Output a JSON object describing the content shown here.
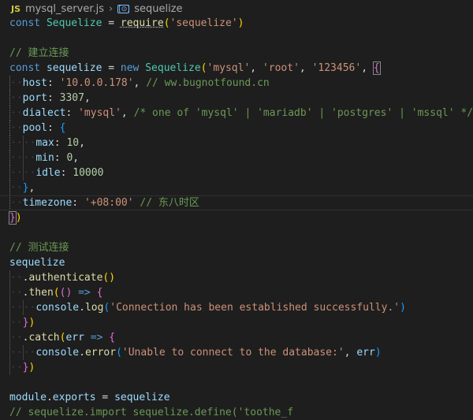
{
  "breadcrumb": {
    "file_icon": "JS",
    "file_name": "mysql_server.js",
    "separator": "›",
    "symbol_icon": "[⊙]",
    "symbol_name": "sequelize"
  },
  "code": {
    "l1": {
      "kw": "const",
      "name": "Sequelize",
      "eq": " = ",
      "fn": "require",
      "arg": "'sequelize'"
    },
    "l3": {
      "comment": "// 建立连接"
    },
    "l4": {
      "kw": "const",
      "name": "sequelize",
      "eq": " = ",
      "new": "new",
      "cls": "Sequelize",
      "a1": "'mysql'",
      "a2": "'root'",
      "a3": "'123456'"
    },
    "l5": {
      "key": "host",
      "val": "'10.0.0.178'",
      "comment": "// ww.bugnotfound.cn"
    },
    "l6": {
      "key": "port",
      "val": "3307"
    },
    "l7": {
      "key": "dialect",
      "val": "'mysql'",
      "comment": "/* one of 'mysql' | 'mariadb' | 'postgres' | 'mssql' */"
    },
    "l8": {
      "key": "pool"
    },
    "l9": {
      "key": "max",
      "val": "10"
    },
    "l10": {
      "key": "min",
      "val": "0"
    },
    "l11": {
      "key": "idle",
      "val": "10000"
    },
    "l13": {
      "key": "timezone",
      "val": "'+08:00'",
      "comment": "// 东八时区"
    },
    "l16": {
      "comment": "// 测试连接"
    },
    "l17": {
      "name": "sequelize"
    },
    "l18": {
      "fn": "authenticate"
    },
    "l19": {
      "fn": "then"
    },
    "l20": {
      "obj": "console",
      "fn": "log",
      "arg": "'Connection has been established successfully.'"
    },
    "l22": {
      "fn": "catch",
      "param": "err"
    },
    "l23": {
      "obj": "console",
      "fn": "error",
      "arg": "'Unable to connect to the database:'",
      "param": "err"
    },
    "l26": {
      "obj": "module",
      "prop": "exports",
      "name": "sequelize"
    },
    "l27": {
      "comment": "// sequelize.import sequelize.define('toothe_f"
    }
  }
}
